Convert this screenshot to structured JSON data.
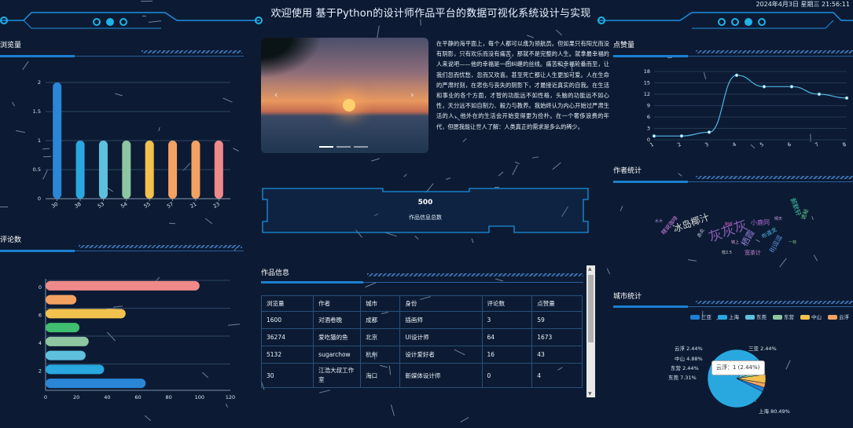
{
  "header": {
    "title": "欢迎使用 基于Python的设计师作品平台的数据可视化系统设计与实现",
    "datetime": "2024年4月3日 星期三 21:56:11"
  },
  "panels": {
    "views": "浏览量",
    "comments": "评论数",
    "likes": "点赞量",
    "authors": "作者统计",
    "works": "作品信息",
    "cities": "城市统计"
  },
  "carousel": {
    "prev": "‹",
    "next": "›"
  },
  "intro_text": "在平静的海平面上，每个人都可以成为领航员。但如果只有阳光而没有阴影，只有欢乐而没有痛苦，那就不是完整的人生。就拿最幸福的人来说吧——他的幸福是一团纠缠的丝线。痛苦和幸福轮番而至，让我们忽而忧愁，忽而又欢喜。甚至死亡都让人生更加可爱。人在生命的严肃时刻，在悲伤与丧失的阴影下，才最接近真实的自我。在生活和事业的各个方面，才智的功能远不如性格，头脑的功能远不如心性，天分远不如自制力、毅力与教养。我始终认为内心开始过严肃生活的人，他外在的生活会开始变得更为俭朴。在一个奢侈浪费的年代，但愿我能让世人了解：人类真正的需求是多么的稀少。",
  "stat": {
    "value": "500",
    "label": "作品信息总数"
  },
  "table": {
    "headers": [
      "浏览量",
      "作者",
      "城市",
      "身份",
      "评论数",
      "点赞量"
    ],
    "rows": [
      [
        "1600",
        "对酒卷晚",
        "成都",
        "插画师",
        "3",
        "59"
      ],
      [
        "36274",
        "爱吃猫的鱼",
        "北京",
        "UI设计师",
        "64",
        "1673"
      ],
      [
        "5132",
        "sugarchow",
        "杭州",
        "设计爱好者",
        "16",
        "43"
      ],
      [
        "30",
        "江浩大叔工作室",
        "海口",
        "新媒体设计师",
        "0",
        "4"
      ]
    ]
  },
  "word_cloud": [
    {
      "text": "灰灰灰",
      "color": "#8b5fb6"
    },
    {
      "text": "冰岛椰汁",
      "color": "#d9d9d9"
    },
    {
      "text": "栖霞",
      "color": "#8e7ad0"
    },
    {
      "text": "小鹿同",
      "color": "#b06bd6"
    },
    {
      "text": "BJ逗逗",
      "color": "#5c8fd8"
    },
    {
      "text": "宽茶计",
      "color": "#c57fcf"
    },
    {
      "text": "郝默轩",
      "color": "#3fd0a8"
    },
    {
      "text": "诡秘",
      "color": "#6ad08c"
    },
    {
      "text": "瞎说咖啡",
      "color": "#d07fe0"
    },
    {
      "text": "布道龙",
      "color": "#4fb8e0"
    },
    {
      "text": "制纸",
      "color": "#d65fc0"
    },
    {
      "text": "赤炎",
      "color": "#c9d0e0"
    },
    {
      "text": "一荷",
      "color": "#7fbf7f"
    },
    {
      "text": "晴天",
      "color": "#bfa0e0"
    },
    {
      "text": "锦上",
      "color": "#e0a0d0"
    },
    {
      "text": "枝2.5",
      "color": "#d0d0d0"
    },
    {
      "text": "水木",
      "color": "#a08fe0"
    }
  ],
  "city_legend": [
    {
      "name": "三亚",
      "color": "#1e7fd6"
    },
    {
      "name": "上海",
      "color": "#29a8e0"
    },
    {
      "name": "东莞",
      "color": "#5ec0dd"
    },
    {
      "name": "东营",
      "color": "#8dc6a0"
    },
    {
      "name": "中山",
      "color": "#f2c14e"
    },
    {
      "name": "云浮",
      "color": "#f4a261"
    }
  ],
  "pie_labels": [
    {
      "text": "三亚 2.44%"
    },
    {
      "text": "云浮 2.44%"
    },
    {
      "text": "中山 4.88%"
    },
    {
      "text": "东营 2.44%"
    },
    {
      "text": "东莞 7.31%"
    },
    {
      "text": "上海 80.49%"
    }
  ],
  "tooltip": "云浮：1 (2.44%)",
  "chart_data": [
    {
      "type": "bar",
      "title": "浏览量",
      "categories": [
        "30",
        "38",
        "53",
        "54",
        "55",
        "57",
        "21",
        "23"
      ],
      "values": [
        2,
        1,
        1,
        1,
        1,
        1,
        1,
        1
      ],
      "ylim": [
        0,
        2
      ],
      "yticks": [
        0,
        0.5,
        1,
        1.5,
        2
      ],
      "colors": [
        "#2a86d6",
        "#29a8e0",
        "#5ec0dd",
        "#8dc6a0",
        "#f2c14e",
        "#f4a261",
        "#f4a261",
        "#f08a8a"
      ]
    },
    {
      "type": "bar",
      "orientation": "horizontal",
      "title": "评论数",
      "y_tick_labels": [
        "0",
        "6",
        "4",
        "2"
      ],
      "values": [
        100,
        20,
        52,
        22,
        28,
        26,
        38,
        65
      ],
      "xlim": [
        0,
        120
      ],
      "xticks": [
        0,
        20,
        40,
        60,
        80,
        100,
        120
      ],
      "colors": [
        "#f08a8a",
        "#f4a261",
        "#f2c14e",
        "#3fbf6f",
        "#8dc6a0",
        "#5ec0dd",
        "#29a8e0",
        "#2a86d6"
      ]
    },
    {
      "type": "line",
      "title": "点赞量",
      "x": [
        "1",
        "2",
        "3",
        "4",
        "5",
        "6",
        "7",
        "8"
      ],
      "values": [
        1,
        1,
        2,
        17,
        14,
        14,
        12,
        11
      ],
      "ylim": [
        0,
        18
      ],
      "yticks": [
        0,
        3,
        6,
        9,
        12,
        15,
        18
      ]
    },
    {
      "type": "pie",
      "title": "城市统计",
      "slices": [
        {
          "name": "上海",
          "value": 80.49
        },
        {
          "name": "东莞",
          "value": 7.31
        },
        {
          "name": "东营",
          "value": 2.44
        },
        {
          "name": "中山",
          "value": 4.88
        },
        {
          "name": "云浮",
          "value": 2.44
        },
        {
          "name": "三亚",
          "value": 2.44
        }
      ]
    }
  ]
}
